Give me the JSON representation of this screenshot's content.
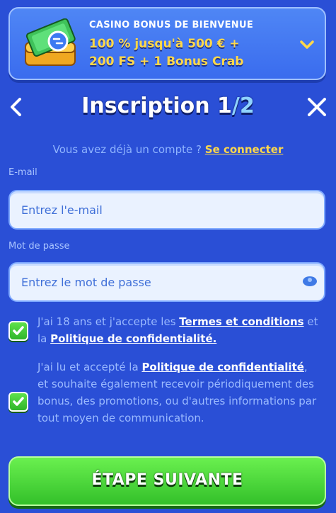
{
  "bonus": {
    "title": "CASINO BONUS DE BIENVENUE",
    "line1": "100 % jusqu'à 500 € +",
    "line2": "200 FS + 1 Bonus Crab"
  },
  "header": {
    "title": "Inscription 1",
    "step_suffix": "/2"
  },
  "login_prompt": {
    "text": "Vous avez déjà un compte ? ",
    "link": "Se connecter"
  },
  "form": {
    "email_label": "E-mail",
    "email_placeholder": "Entrez l'e-mail",
    "password_label": "Mot de passe",
    "password_placeholder": "Entrez le mot de passe"
  },
  "consents": [
    {
      "checked": true,
      "t1": "J'ai 18 ans et j'accepte les ",
      "l1": "Termes et conditions",
      "t2": " et la ",
      "l2": "Politique de confidentialité."
    },
    {
      "checked": true,
      "t1": "J'ai lu et accepté la ",
      "l1": "Politique de confidentialité",
      "t2": ", et souhaite également recevoir périodiquement des bonus, des promotions, ou d'autres informations par tout moyen de communication."
    }
  ],
  "next_button": "ÉTAPE SUIVANTE",
  "colors": {
    "accent": "#ffd84a",
    "background": "#2a4fd6",
    "button": "#33c02a"
  }
}
